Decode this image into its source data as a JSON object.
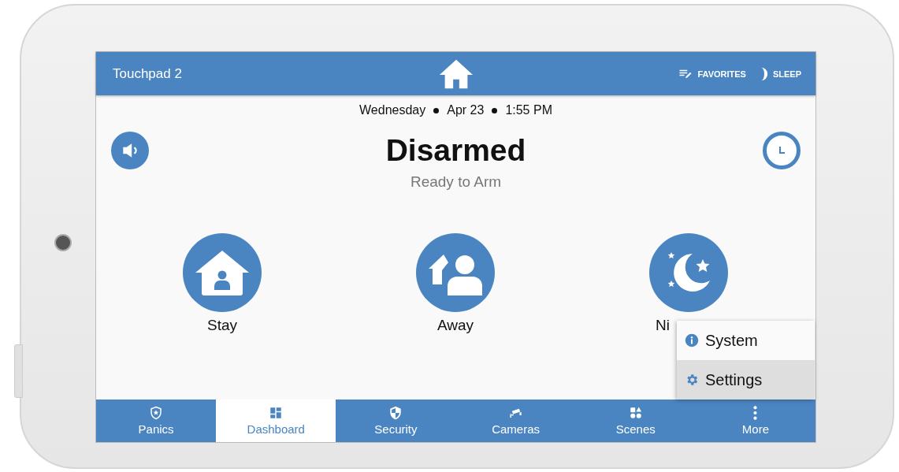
{
  "header": {
    "title": "Touchpad 2",
    "actions": [
      {
        "label": "FAVORITES",
        "kind": "favorites"
      },
      {
        "label": "SLEEP",
        "kind": "sleep"
      }
    ]
  },
  "datetime": {
    "day": "Wednesday",
    "date": "Apr 23",
    "time": "1:55 PM"
  },
  "status": {
    "title": "Disarmed",
    "subtitle": "Ready to Arm"
  },
  "arm_modes": [
    {
      "label": "Stay",
      "kind": "stay"
    },
    {
      "label": "Away",
      "kind": "away"
    },
    {
      "label": "Ni",
      "kind": "night"
    }
  ],
  "menu": {
    "items": [
      {
        "label": "System",
        "kind": "info",
        "selected": false
      },
      {
        "label": "Settings",
        "kind": "gear",
        "selected": true
      }
    ]
  },
  "tabs": [
    {
      "label": "Panics",
      "kind": "panic",
      "selected": false
    },
    {
      "label": "Dashboard",
      "kind": "dashboard",
      "selected": true
    },
    {
      "label": "Security",
      "kind": "security",
      "selected": false
    },
    {
      "label": "Cameras",
      "kind": "cameras",
      "selected": false
    },
    {
      "label": "Scenes",
      "kind": "scenes",
      "selected": false
    },
    {
      "label": "More",
      "kind": "more",
      "selected": false
    }
  ]
}
